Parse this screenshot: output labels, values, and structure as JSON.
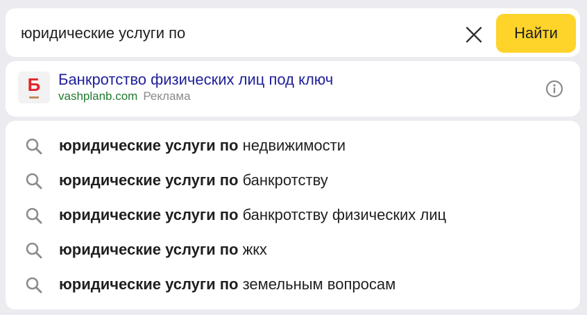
{
  "search": {
    "query": "юридические услуги по",
    "clear_icon": "close-icon",
    "button_label": "Найти",
    "accent_color": "#fed42b"
  },
  "ad": {
    "logo_letter": "Б",
    "title": "Банкротство физических лиц под ключ",
    "domain": "vashplanb.com",
    "label": "Реклама",
    "info_icon": "info-icon"
  },
  "suggestions": [
    {
      "prefix": "юридические услуги по",
      "suffix": "недвижимости"
    },
    {
      "prefix": "юридические услуги по",
      "suffix": "банкротству"
    },
    {
      "prefix": "юридические услуги по",
      "suffix": "банкротству физических лиц"
    },
    {
      "prefix": "юридические услуги по",
      "suffix": "жкх"
    },
    {
      "prefix": "юридические услуги по",
      "suffix": "земельным вопросам"
    }
  ]
}
